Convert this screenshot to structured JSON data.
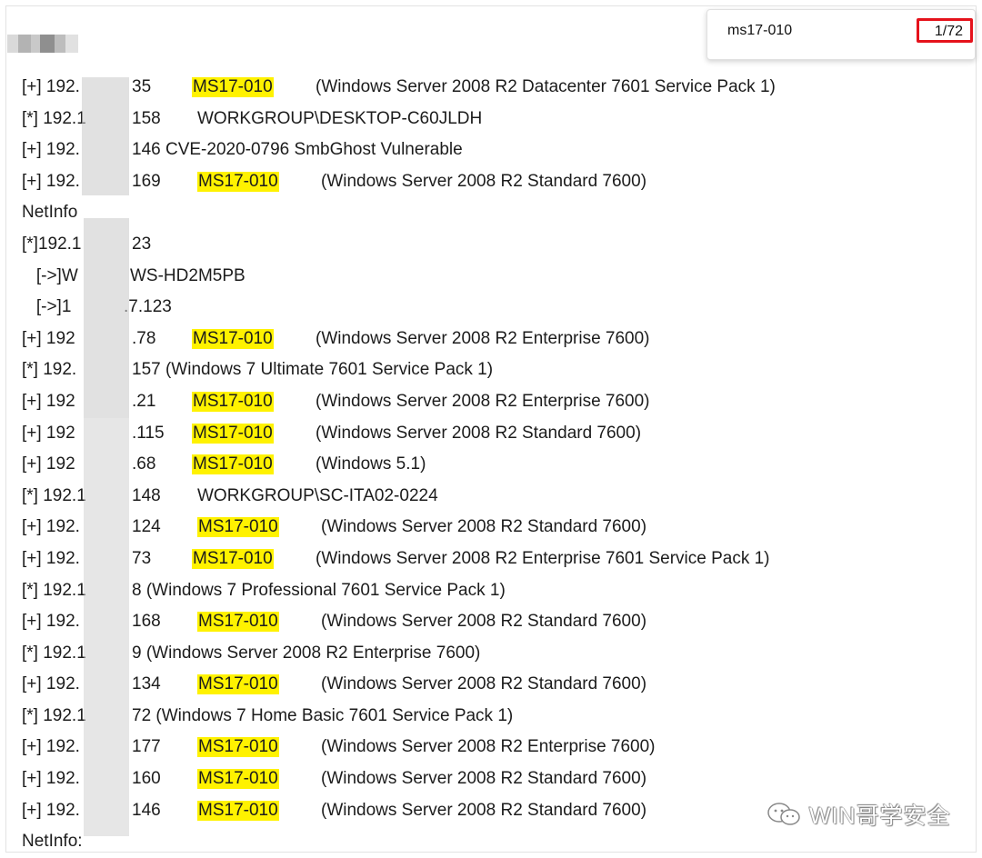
{
  "find_bar": {
    "query": "ms17-010",
    "count": "1/72"
  },
  "log_rows": [
    {
      "prefix": "[+] 192.",
      "suffix": "35",
      "tag": "MS17-010",
      "info": "(Windows Server 2008 R2 Datacenter 7601 Service Pack 1)"
    },
    {
      "prefix": "[*] 192.1",
      "suffix": "158",
      "tag": "",
      "info": "WORKGROUP\\DESKTOP-C60JLDH"
    },
    {
      "prefix": "[+] 192.",
      "suffix": "146 CVE-2020-0796 SmbGhost Vulnerable",
      "tag": "",
      "info": ""
    },
    {
      "prefix": "[+] 192.",
      "suffix": "169",
      "tag": "MS17-010",
      "info": "(Windows Server 2008 R2 Standard 7600)"
    },
    {
      "prefix": "NetInfo",
      "suffix": "",
      "tag": "",
      "info": ""
    },
    {
      "prefix": "[*]192.1",
      "suffix": "23",
      "tag": "",
      "info": ""
    },
    {
      "prefix": "   [->]W",
      "suffix": "WS-HD2M5PB",
      "tag": "",
      "info": ""
    },
    {
      "prefix": "   [->]1",
      "suffix": ".7.123",
      "tag": "",
      "info": ""
    },
    {
      "prefix": "[+] 192",
      "suffix": ".78",
      "tag": "MS17-010",
      "info": "(Windows Server 2008 R2 Enterprise 7600)"
    },
    {
      "prefix": "[*] 192.",
      "suffix": "157  (Windows 7 Ultimate 7601 Service Pack 1)",
      "tag": "",
      "info": ""
    },
    {
      "prefix": "[+] 192",
      "suffix": ".21",
      "tag": "MS17-010",
      "info": "(Windows Server 2008 R2 Enterprise 7600)"
    },
    {
      "prefix": "[+] 192",
      "suffix": ".115",
      "tag": "MS17-010",
      "info": "(Windows Server 2008 R2 Standard 7600)"
    },
    {
      "prefix": "[+] 192",
      "suffix": ".68",
      "tag": "MS17-010",
      "info": "(Windows 5.1)"
    },
    {
      "prefix": "[*] 192.1",
      "suffix": "148",
      "tag": "",
      "info": "WORKGROUP\\SC-ITA02-0224"
    },
    {
      "prefix": "[+] 192.",
      "suffix": "124",
      "tag": "MS17-010",
      "info": "(Windows Server 2008 R2 Standard 7600)"
    },
    {
      "prefix": "[+] 192.",
      "suffix": "73",
      "tag": "MS17-010",
      "info": "(Windows Server 2008 R2 Enterprise 7601 Service Pack 1)"
    },
    {
      "prefix": "[*] 192.1",
      "suffix": "8  (Windows 7 Professional 7601 Service Pack 1)",
      "tag": "",
      "info": ""
    },
    {
      "prefix": "[+] 192.",
      "suffix": "168",
      "tag": "MS17-010",
      "info": "(Windows Server 2008 R2 Standard 7600)"
    },
    {
      "prefix": "[*] 192.1",
      "suffix": "9  (Windows Server 2008 R2 Enterprise 7600)",
      "tag": "",
      "info": ""
    },
    {
      "prefix": "[+] 192.",
      "suffix": "134",
      "tag": "MS17-010",
      "info": "(Windows Server 2008 R2 Standard 7600)"
    },
    {
      "prefix": "[*] 192.1",
      "suffix": "72  (Windows 7 Home Basic 7601 Service Pack 1)",
      "tag": "",
      "info": ""
    },
    {
      "prefix": "[+] 192.",
      "suffix": "177",
      "tag": "MS17-010",
      "info": "(Windows Server 2008 R2 Enterprise 7600)"
    },
    {
      "prefix": "[+] 192.",
      "suffix": "160",
      "tag": "MS17-010",
      "info": "(Windows Server 2008 R2 Standard 7600)"
    },
    {
      "prefix": "[+] 192.",
      "suffix": "146",
      "tag": "MS17-010",
      "info": "(Windows Server 2008 R2 Standard 7600)"
    },
    {
      "prefix": "NetInfo:",
      "suffix": "",
      "tag": "",
      "info": ""
    }
  ],
  "watermark": {
    "text": "WIN哥学安全",
    "icon": "wechat-icon"
  },
  "colors": {
    "highlight": "#fff200",
    "find_count_border": "#e5121b"
  }
}
